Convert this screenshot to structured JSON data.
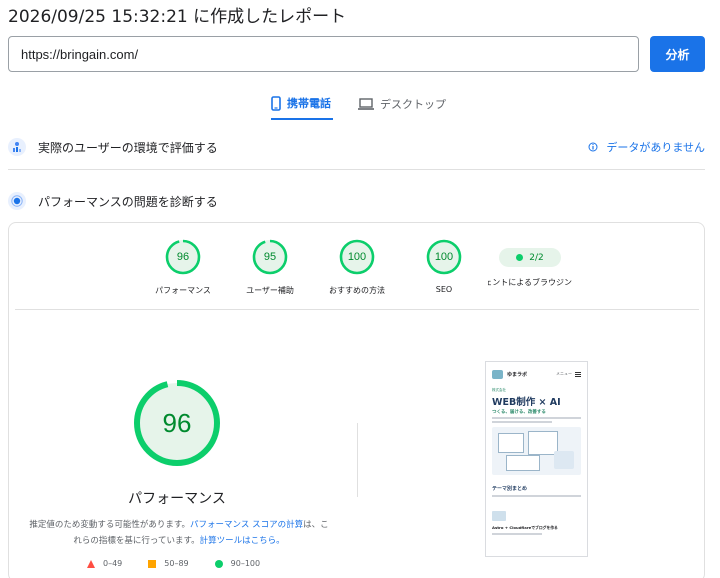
{
  "report": {
    "title": "2026/09/25 15:32:21 に作成したレポート"
  },
  "url_bar": {
    "value": "https://bringain.com/",
    "analyze_label": "分析"
  },
  "tabs": [
    {
      "label": "携帯電話",
      "icon": "smartphone-icon",
      "selected": true
    },
    {
      "label": "デスクトップ",
      "icon": "laptop-icon",
      "selected": false
    }
  ],
  "field_section": {
    "title": "実際のユーザーの環境で評価する",
    "icon": "users-chart-icon",
    "no_data_label": "データがありません",
    "no_data_icon": "info-icon"
  },
  "diagnose_section": {
    "title": "パフォーマンスの問題を診断する",
    "icon": "lab-icon"
  },
  "categories": [
    {
      "label": "パフォーマンス",
      "score": "96"
    },
    {
      "label": "ユーザー補助",
      "score": "95"
    },
    {
      "label": "おすすめの方法",
      "score": "100"
    },
    {
      "label": "SEO",
      "score": "100"
    },
    {
      "label": "ージェントによるブラウジン",
      "badge": "2/2"
    }
  ],
  "performance": {
    "score": "96",
    "label": "パフォーマンス",
    "note_prefix": "推定値のため変動する可能性があります。",
    "note_link1": "パフォーマンス スコアの計算",
    "note_mid": "は、これらの指標を基に行っています。",
    "note_link2": "計算ツールはこちら。"
  },
  "legend": [
    {
      "label": "0–49",
      "shape": "triangle",
      "color": "#ff4e42"
    },
    {
      "label": "50–89",
      "shape": "square",
      "color": "#ffa400"
    },
    {
      "label": "90–100",
      "shape": "circle",
      "color": "#0cce6b"
    }
  ],
  "screenshot": {
    "site_name": "ゆまラボ",
    "menu_label": "メニュー",
    "kicker": "株式会社",
    "headline": "WEB制作 × AI",
    "tagline": "つくる、届ける、改善する",
    "section_title": "テーマ別まとめ",
    "item_title": "Astro + Cloudflareでブログを作る"
  },
  "colors": {
    "accent": "#1a73e8",
    "pass": "#0cce6b",
    "pass_text": "#008a2e",
    "pass_bg": "#e6f4ea"
  }
}
